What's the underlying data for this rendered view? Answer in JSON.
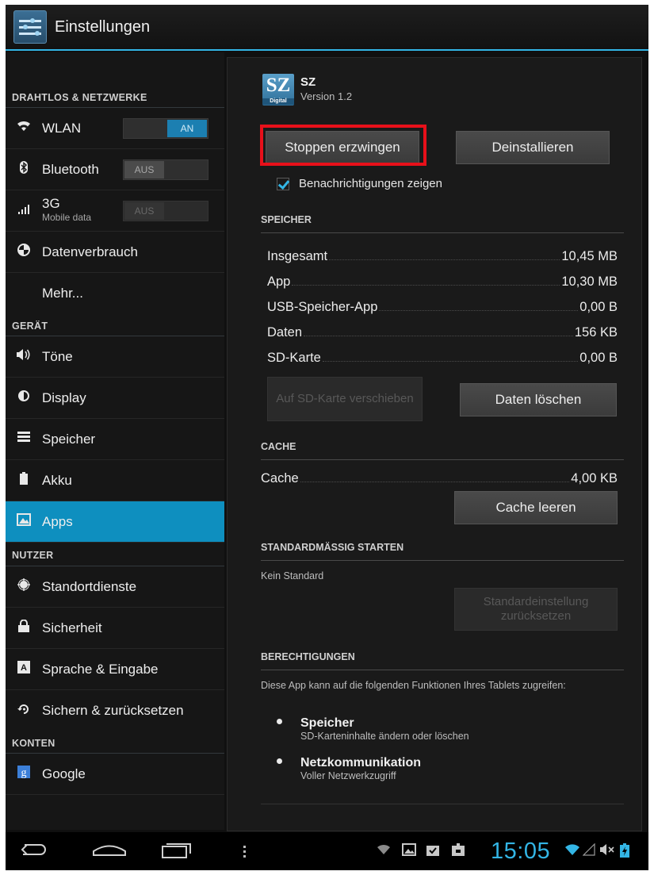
{
  "actionbar": {
    "title": "Einstellungen"
  },
  "sidebar": {
    "section_wireless": "DRAHTLOS & NETZWERKE",
    "wlan": {
      "label": "WLAN",
      "toggle": "AN"
    },
    "bluetooth": {
      "label": "Bluetooth",
      "toggle": "AUS"
    },
    "mobile": {
      "label": "3G",
      "sub": "Mobile data",
      "toggle": "AUS"
    },
    "data_usage": "Datenverbrauch",
    "more": "Mehr...",
    "section_device": "GERÄT",
    "sound": "Töne",
    "display": "Display",
    "storage": "Speicher",
    "battery": "Akku",
    "apps": "Apps",
    "section_user": "NUTZER",
    "location": "Standortdienste",
    "security": "Sicherheit",
    "language": "Sprache & Eingabe",
    "backup": "Sichern & zurücksetzen",
    "section_accounts": "KONTEN",
    "google": "Google"
  },
  "detail": {
    "logo_text": "SZ",
    "logo_sub": "Digital",
    "app_name": "SZ",
    "version": "Version 1.2",
    "force_stop": "Stoppen erzwingen",
    "uninstall": "Deinstallieren",
    "show_notifications": "Benachrichtigungen zeigen",
    "storage_header": "SPEICHER",
    "storage_rows": [
      {
        "label": "Insgesamt",
        "value": "10,45 MB"
      },
      {
        "label": "App",
        "value": "10,30 MB"
      },
      {
        "label": "USB-Speicher-App",
        "value": "0,00 B"
      },
      {
        "label": "Daten",
        "value": "156 KB"
      },
      {
        "label": "SD-Karte",
        "value": "0,00 B"
      }
    ],
    "move_to_sd": "Auf SD-Karte verschieben",
    "clear_data": "Daten löschen",
    "cache_header": "CACHE",
    "cache_row": {
      "label": "Cache",
      "value": "4,00 KB"
    },
    "clear_cache": "Cache leeren",
    "default_header": "STANDARDMÄSSIG STARTEN",
    "no_default": "Kein Standard",
    "reset_default": "Standardeinstellung zurücksetzen",
    "permissions_header": "BERECHTIGUNGEN",
    "permissions_desc": "Diese App kann auf die folgenden Funktionen Ihres Tablets zugreifen:",
    "permissions": [
      {
        "title": "Speicher",
        "desc": "SD-Karteninhalte ändern oder löschen"
      },
      {
        "title": "Netzkommunikation",
        "desc": "Voller Netzwerkzugriff"
      }
    ]
  },
  "statusbar": {
    "time": "15:05"
  },
  "colors": {
    "accent": "#33b5e5",
    "selected": "#0e8fbf",
    "highlight": "#e8101a"
  }
}
